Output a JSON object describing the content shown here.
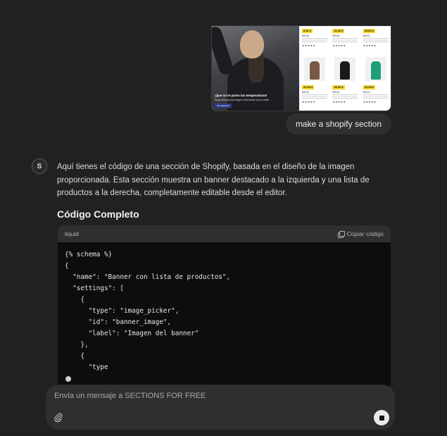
{
  "user_message": {
    "text": "make a shopify section",
    "attachment": {
      "banner_headline": "¡Que no te paren las temperaturas!",
      "banner_subtext": "Ropa técnica para seguir entrenando con tu estilo",
      "banner_button": "Ver selección",
      "products": [
        {
          "price": "6,51 €",
          "name": "NEGA"
        },
        {
          "price": "11,29 €",
          "name": "NEGA"
        },
        {
          "price": "15,69 €",
          "name": "NEGA"
        },
        {
          "price": "",
          "name": ""
        },
        {
          "price": "",
          "name": ""
        },
        {
          "price": "",
          "name": ""
        },
        {
          "price": "20,99 €",
          "name": "NEGA"
        },
        {
          "price": "25,99 €",
          "name": "NEGA"
        },
        {
          "price": "13,99 €",
          "name": "NEGA"
        }
      ]
    }
  },
  "assistant": {
    "avatar_glyph": "S",
    "intro": "Aquí tienes el código de una sección de Shopify, basada en el diseño de la imagen proporcionada. Esta sección muestra un banner destacado a la izquierda y una lista de productos a la derecha, completamente editable desde el editor.",
    "heading": "Código Completo",
    "code": {
      "language": "liquid",
      "copy_label": "Copiar código",
      "content": "{% schema %}\n{\n  \"name\": \"Banner con lista de productos\",\n  \"settings\": [\n    {\n      \"type\": \"image_picker\",\n      \"id\": \"banner_image\",\n      \"label\": \"Imagen del banner\"\n    },\n    {\n      \"type"
    }
  },
  "composer": {
    "placeholder": "Envía un mensaje a SECTIONS FOR FREE"
  },
  "icons": {
    "attach": "paperclip-icon",
    "stop": "stop-icon",
    "copy": "copy-icon"
  }
}
